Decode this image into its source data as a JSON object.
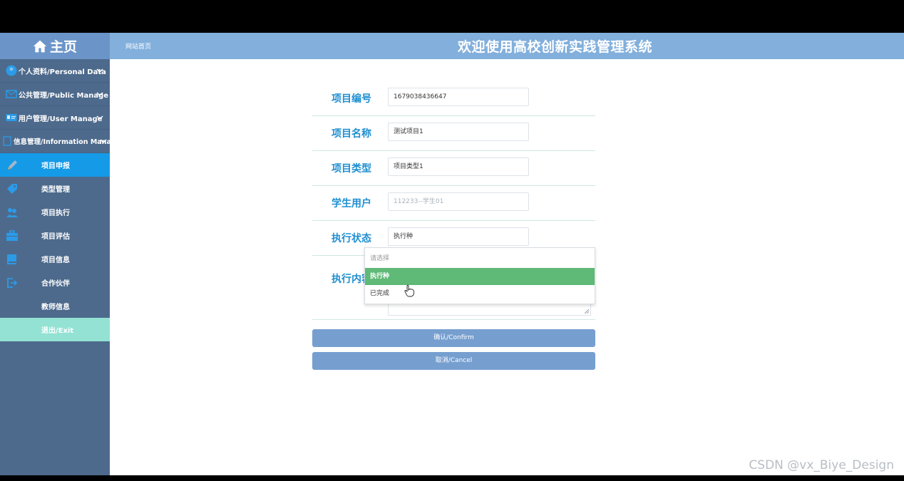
{
  "brand": {
    "label": "主页",
    "icon": "home-icon"
  },
  "header": {
    "home_link": "网站首页",
    "title": "欢迎使用高校创新实践管理系统"
  },
  "sidebar": {
    "groups": [
      {
        "label": "个人资料/Personal Data",
        "icon": "user-circle-icon"
      },
      {
        "label": "公共管理/Public Manage",
        "icon": "mail-icon"
      },
      {
        "label": "用户管理/User Manage",
        "icon": "id-card-icon"
      },
      {
        "label": "信息管理/Information Manage",
        "icon": "info-icon"
      }
    ],
    "items": [
      {
        "label": "项目申报",
        "icon": "pencil-icon",
        "active": true
      },
      {
        "label": "类型管理",
        "icon": "tag-icon"
      },
      {
        "label": "项目执行",
        "icon": "people-icon"
      },
      {
        "label": "项目评估",
        "icon": "briefcase-icon"
      },
      {
        "label": "项目信息",
        "icon": "book-icon"
      },
      {
        "label": "合作伙伴",
        "icon": "logout-icon"
      },
      {
        "label": "教师信息",
        "icon": ""
      }
    ],
    "exit": "退出/Exit"
  },
  "form": {
    "project_no": {
      "label": "项目编号",
      "value": "1679038436647"
    },
    "project_name": {
      "label": "项目名称",
      "value": "测试项目1"
    },
    "project_type": {
      "label": "项目类型",
      "value": "项目类型1"
    },
    "student_user": {
      "label": "学生用户",
      "value": "112233--学生01"
    },
    "exec_status": {
      "label": "执行状态",
      "value": "执行种"
    },
    "exec_content": {
      "label": "执行内容"
    }
  },
  "dropdown": {
    "options": [
      "请选择",
      "执行种",
      "已完成"
    ],
    "selected": "执行种"
  },
  "buttons": {
    "confirm": "确认/Confirm",
    "cancel": "取消/Cancel"
  },
  "watermark": "CSDN @vx_Biye_Design",
  "colors": {
    "sidebar": "#4d6a8c",
    "header": "#82afdc",
    "active": "#159ae8",
    "exit": "#93e2d3",
    "selected_option": "#5fb977",
    "button": "#769fd0"
  }
}
